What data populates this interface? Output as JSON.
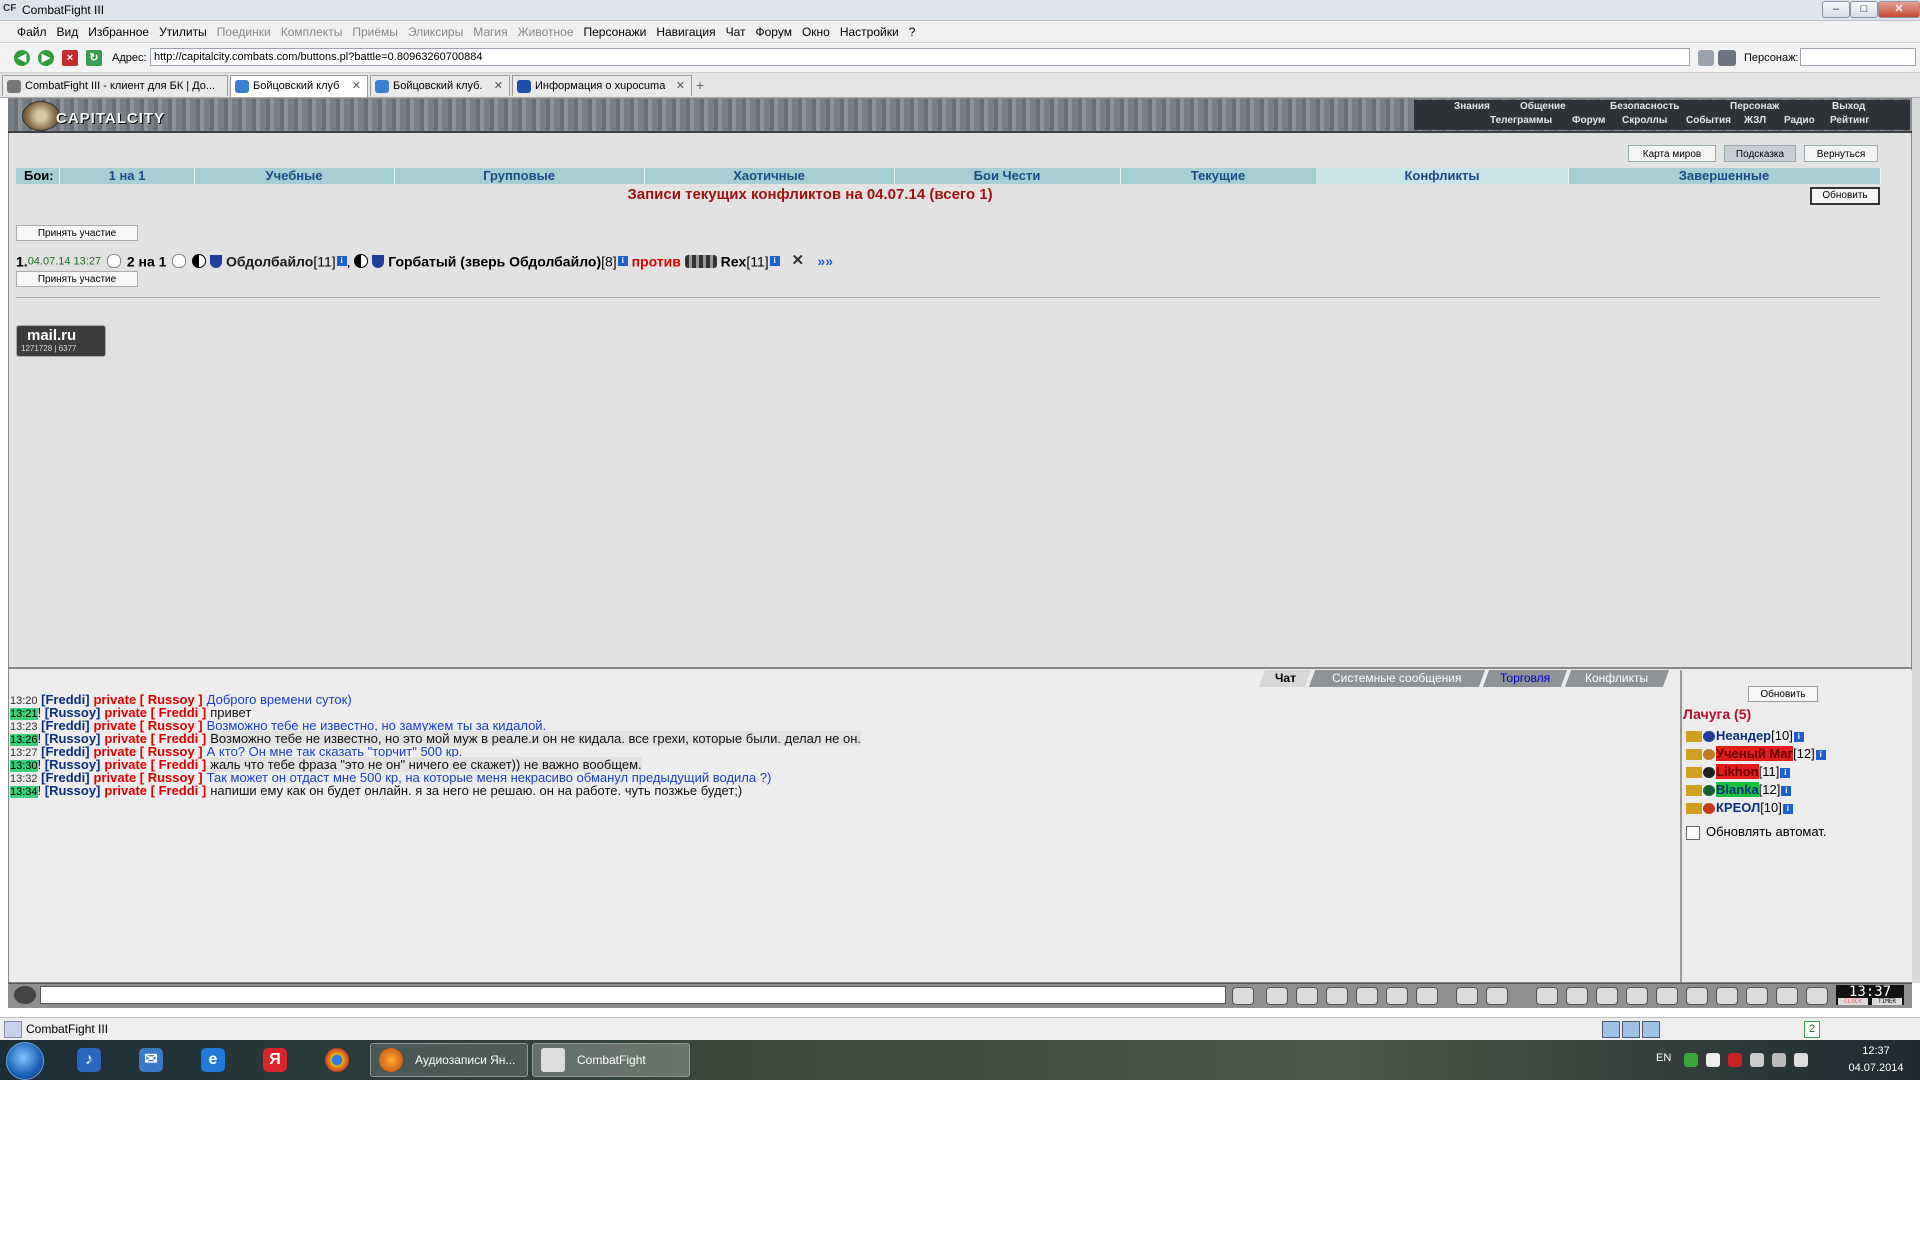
{
  "window": {
    "title": "CombatFight III",
    "logo_text": "CF",
    "btn_min": "–",
    "btn_max": "□",
    "btn_close": "✕"
  },
  "menu": [
    {
      "label": "Файл",
      "dim": false
    },
    {
      "label": "Вид",
      "dim": false
    },
    {
      "label": "Избранное",
      "dim": false
    },
    {
      "label": "Утилиты",
      "dim": false
    },
    {
      "label": "Поединки",
      "dim": true
    },
    {
      "label": "Комплекты",
      "dim": true
    },
    {
      "label": "Приёмы",
      "dim": true
    },
    {
      "label": "Эликсиры",
      "dim": true
    },
    {
      "label": "Магия",
      "dim": true
    },
    {
      "label": "Животное",
      "dim": true
    },
    {
      "label": "Персонажи",
      "dim": false
    },
    {
      "label": "Навигация",
      "dim": false
    },
    {
      "label": "Чат",
      "dim": false
    },
    {
      "label": "Форум",
      "dim": false
    },
    {
      "label": "Окно",
      "dim": false
    },
    {
      "label": "Настройки",
      "dim": false
    },
    {
      "label": "?",
      "dim": false
    }
  ],
  "address": {
    "label": "Адрес:",
    "url": "http://capitalcity.combats.com/buttons.pl?battle=0.80963260700884",
    "persona_label": "Персонаж:"
  },
  "tabs": [
    {
      "label": "CombatFight III - клиент для БК | До...",
      "active": false
    },
    {
      "label": "Бойцовский клуб",
      "active": true
    },
    {
      "label": "Бойцовский клуб.",
      "active": false
    },
    {
      "label": "Информация о xupocuma",
      "active": false
    }
  ],
  "tab_new": "+",
  "tab_close": "✕",
  "game": {
    "brand": "CAPITALCITY",
    "topnav_row1": [
      "Знания",
      "Общение",
      "Безопасность",
      "Персонаж",
      "Выход"
    ],
    "topnav_row2": [
      "Телеграммы",
      "Форум",
      "Скроллы",
      "События",
      "ЖЗЛ",
      "Радио",
      "Рейтинг"
    ],
    "side_buttons": [
      {
        "label": "Карта миров",
        "active": false
      },
      {
        "label": "Подсказка",
        "active": true
      },
      {
        "label": "Вернуться",
        "active": false
      }
    ],
    "categories_label": "Бои:",
    "categories": [
      {
        "label": "1 на 1",
        "active": false
      },
      {
        "label": "Учебные",
        "active": false
      },
      {
        "label": "Групповые",
        "active": false
      },
      {
        "label": "Хаотичные",
        "active": false
      },
      {
        "label": "Бои Чести",
        "active": false
      },
      {
        "label": "Текущие",
        "active": false
      },
      {
        "label": "Конфликты",
        "active": true
      },
      {
        "label": "Завершенные",
        "active": false
      }
    ],
    "heading": "Записи текущих конфликтов на 04.07.14 (всего 1)",
    "refresh": "Обновить",
    "join": "Принять участие",
    "conflict": {
      "index": "1.",
      "datetime": "04.07.14 13:27",
      "mode": "2 на 1",
      "player1": "Обдолбайло",
      "player1_level": "[11]",
      "player2": "Горбатый (зверь Обдолбайло)",
      "player2_level": "[8]",
      "versus": "против",
      "player3": "Rex",
      "player3_level": "[11]",
      "more": "»»"
    },
    "info_badge": "i",
    "counter": {
      "logo": "mail.ru",
      "stats": "1271728 | 6377"
    }
  },
  "chat": {
    "tabs": [
      {
        "label": "Чат",
        "active": true,
        "blue": false
      },
      {
        "label": "Системные сообщения",
        "active": false,
        "blue": false
      },
      {
        "label": "Торговля",
        "active": false,
        "blue": true
      },
      {
        "label": "Конфликты",
        "active": false,
        "blue": false
      }
    ],
    "messages": [
      {
        "time": "13:20",
        "hl": false,
        "from": "[Freddi]",
        "private": "private [ Russoy ]",
        "text": "Доброго времени суток)",
        "blue": true,
        "band": false
      },
      {
        "time": "13:21",
        "hl": true,
        "from": "[Russoy]",
        "private": "private [ Freddi ]",
        "text": "привет",
        "blue": false,
        "band": false
      },
      {
        "time": "13:23",
        "hl": false,
        "from": "[Freddi]",
        "private": "private [ Russoy ]",
        "text": "Возможно тебе не известно, но замужем ты за кидалой.",
        "blue": true,
        "band": false
      },
      {
        "time": "13:26",
        "hl": true,
        "from": "[Russoy]",
        "private": "private [ Freddi ]",
        "text": "Возможно тебе не известно, но это мой муж в реале.и он не кидала. все грехи, которые были. делал не он.",
        "blue": false,
        "band": true
      },
      {
        "time": "13:27",
        "hl": false,
        "from": "[Freddi]",
        "private": "private [ Russoy ]",
        "text": "А кто? Он мне так сказать \"торчит\" 500 кр.",
        "blue": true,
        "band": false
      },
      {
        "time": "13:30",
        "hl": true,
        "from": "[Russoy]",
        "private": "private [ Freddi ]",
        "text": "жаль что тебе фраза \"это не он\" ничего ее скажет)) не важно вообщем.",
        "blue": false,
        "band": true
      },
      {
        "time": "13:32",
        "hl": false,
        "from": "[Freddi]",
        "private": "private [ Russoy ]",
        "text": "Так может он отдаст мне 500 кр, на которые меня некрасиво обманул предыдущий водила ?)",
        "blue": true,
        "band": false
      },
      {
        "time": "13:34",
        "hl": true,
        "from": "[Russoy]",
        "private": "private [ Freddi ]",
        "text": "напиши ему как он будет онлайн. я за него не решаю. он на работе. чуть позжье будет;)",
        "blue": false,
        "band": false
      }
    ],
    "users_refresh": "Обновить",
    "room": "Лачуга (5)",
    "users": [
      {
        "name": "Неандер",
        "level": "[10]",
        "style": ""
      },
      {
        "name": "Ученый Маг",
        "level": "[12]",
        "style": "red"
      },
      {
        "name": "Likhon",
        "level": "[11]",
        "style": "red"
      },
      {
        "name": "Blanka",
        "level": "[12]",
        "style": "green"
      },
      {
        "name": "КРЕОЛ",
        "level": "[10]",
        "style": ""
      }
    ],
    "auto_refresh": "Обновлять автомат.",
    "clock": "13:37",
    "clock_label": "CLOCK",
    "timer_label": "TIMER"
  },
  "statusbar": {
    "title": "CombatFight III",
    "counter": "2"
  },
  "taskbar": {
    "windows": [
      {
        "label": "Аудиозаписи Ян..."
      },
      {
        "label": "CombatFight"
      }
    ],
    "lang": "EN",
    "time": "12:37",
    "date": "04.07.2014"
  },
  "colors": {
    "accent": "#a0120f",
    "category_bar": "#a6cfd5",
    "link": "#1b4a86"
  }
}
